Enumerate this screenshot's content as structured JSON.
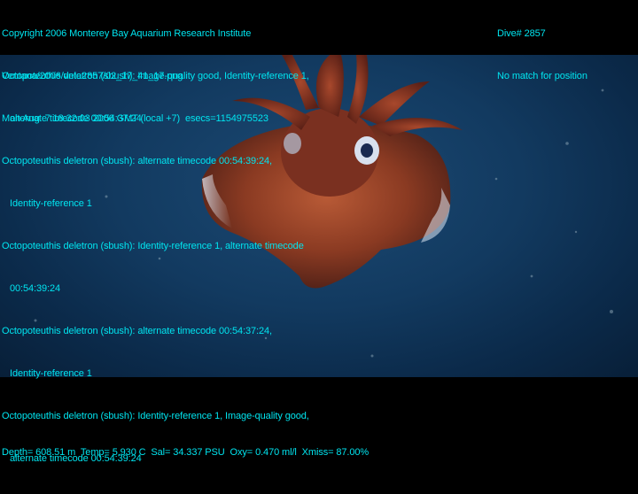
{
  "header": {
    "copyright": "Copyright 2006 Monterey Bay Aquarium Research Institute",
    "file_path": "Ventana/2006/vnta2857/02_17_41_17.png",
    "datetime": "Mon Aug  7 18:32:03 2006 GMT (local +7)  esecs=1154975523",
    "dive": "Dive# 2857",
    "position": "No match for position"
  },
  "annotations": [
    {
      "line1": "Octopoteuthis deletron (sbush): Image-quality good, Identity-reference 1,",
      "line2": "alternate timecode 00:54:37:24"
    },
    {
      "line1": "Octopoteuthis deletron (sbush): alternate timecode 00:54:39:24,",
      "line2": "Identity-reference 1"
    },
    {
      "line1": "Octopoteuthis deletron (sbush): Identity-reference 1, alternate timecode",
      "line2": "00:54:39:24"
    },
    {
      "line1": "Octopoteuthis deletron (sbush): alternate timecode 00:54:37:24,",
      "line2": "Identity-reference 1"
    },
    {
      "line1": "Octopoteuthis deletron (sbush): Identity-reference 1, Image-quality good,",
      "line2": "alternate timecode 00:54:39:24"
    }
  ],
  "footer": {
    "sensors": "Depth= 608.51 m  Temp= 5.930 C  Sal= 34.337 PSU  Oxy= 0.470 ml/l  Xmiss= 87.00%"
  }
}
